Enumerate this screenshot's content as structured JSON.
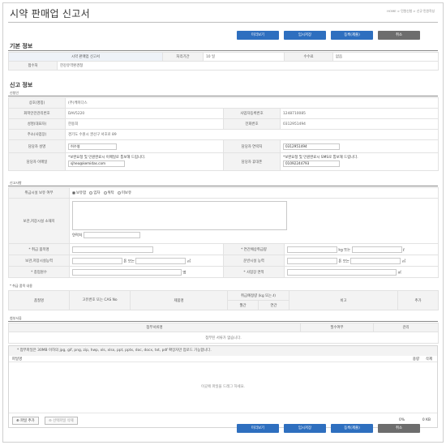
{
  "header": {
    "title": "시약 판매업 신고서",
    "breadcrumb": "HOME > 민원신청 > 신규 민원작성"
  },
  "toolbar": {
    "preview": "미리보기",
    "temp_save": "임시저장",
    "submit": "등록(제출)",
    "cancel": "취소"
  },
  "basic": {
    "section_title": "기본 정보",
    "row1_value": "시약 판매업 신고서",
    "period_label": "처리기간",
    "period_value": "10 일",
    "fee_label": "수수료",
    "fee_value": "없음",
    "agency_label": "접수처",
    "agency_value": "한강유역환경청"
  },
  "report": {
    "section_title": "신고 정보",
    "applicant_sub": "신청인",
    "company_label": "상호(명칭)",
    "company_value": "(주)케미다스",
    "chem_id_label": "화학안전관리번호",
    "chem_id_value": "DAV5220",
    "biz_no_label": "사업자등록번호",
    "biz_no_value": "1248710085",
    "rep_label": "성명(대표자)",
    "rep_value": "한용희",
    "phone_label": "전화번호",
    "phone_value": "0312951494",
    "addr_label": "주소(사업장)",
    "addr_value": "경기도 수원시 권선구 서호로 89",
    "manager_label": "담당자 성명",
    "manager_value": "허수영",
    "manager_contact_label": "담당자 연락처",
    "manager_contact_value": "0312951494",
    "email_label": "담당자 이메일",
    "email_note": "*보완요청 및 민원완료시 이메일로 통보해 드립니다.",
    "email_value": "sjheo@kemidas.com",
    "mobile_label": "담당자 휴대폰",
    "mobile_note": "*보완요청 및 민원완료시 SMS로 통보해 드립니다.",
    "mobile_value": "01092244793"
  },
  "items": {
    "sub": "신고사항",
    "storage_yn_label": "취급시설 보유 여부",
    "radio_options": [
      "보유함",
      "임차",
      "위탁",
      "미보유"
    ],
    "storage_addr_label": "보관,저장시설 소재지",
    "contact_label": "연락처",
    "hazard_label": "* 취급 품목명",
    "annual_label": "* 연간예상취급량",
    "annual_unit1": "kg 또는",
    "annual_unit2": "ℓ",
    "capacity_label": "보관,저장시설능력",
    "capacity_unit1": "톤 또는",
    "capacity_unit2": "㎥",
    "transport_label": "운반시설 능력",
    "transport_unit1": "톤 또는",
    "transport_unit2": "㎥",
    "staff_label": "* 종업원수",
    "staff_unit": "명",
    "area_label": "* 사업장 면적",
    "area_unit": "㎡"
  },
  "goods": {
    "sub": "* 취급 품목 내용",
    "col_name": "품질명",
    "col_cas": "고유번호 또는 CAS No",
    "col_product": "제품명",
    "col_amount": "취급예정량 (kg 또는 ℓ)",
    "col_month": "월간",
    "col_year": "연간",
    "col_note": "비고",
    "add": "추가"
  },
  "attach": {
    "sub": "첨부서류",
    "col_doc": "첨부서류명",
    "col_required": "필수여부",
    "col_manage": "관리",
    "empty_msg": "첨부된 서류가 없습니다.",
    "notice": "* 첨부파일은 30MB 이하의 jpg, gif, png, zip, hwp, xls, xlsx, ppt, pptx, doc, docx, txt, pdf 확장자만 업로드 가능합니다.",
    "col_file": "파일명",
    "col_size": "용량",
    "col_del": "삭제",
    "drop_msg": "이곳에 파일을 드래그 하세요.",
    "add_file": "파일 추가",
    "del_file": "선택파일 삭제",
    "percent": "0%",
    "size_total": "0 KB"
  }
}
